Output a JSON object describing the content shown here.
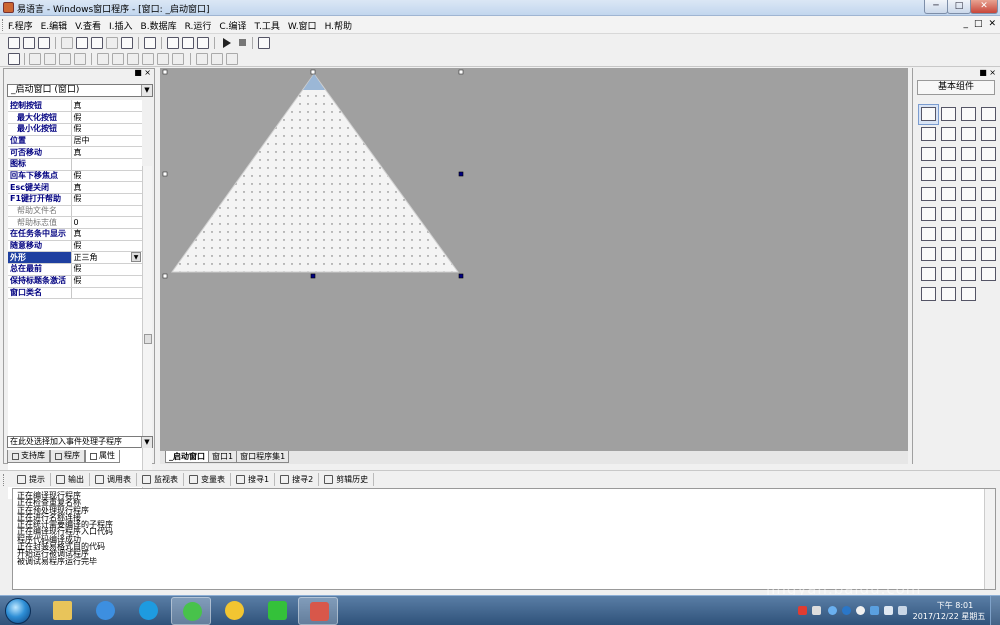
{
  "window": {
    "title": "易语言 - Windows窗口程序 - [窗口: _启动窗口]",
    "min_label": "─",
    "max_label": "□",
    "close_label": "✕"
  },
  "menu": {
    "items": [
      "F.程序",
      "E.编辑",
      "V.查看",
      "I.插入",
      "B.数据库",
      "R.运行",
      "C.编译",
      "T.工具",
      "W.窗口",
      "H.帮助"
    ],
    "mdi": [
      "_",
      "□",
      "✕"
    ]
  },
  "left_panel": {
    "header_controls": "■ ×",
    "window_select": "_启动窗口 (窗口)",
    "properties": [
      {
        "name": "控制按钮",
        "value": "真"
      },
      {
        "name": "最大化按钮",
        "value": "假",
        "sub": true
      },
      {
        "name": "最小化按钮",
        "value": "假",
        "sub": true
      },
      {
        "name": "位置",
        "value": "居中"
      },
      {
        "name": "可否移动",
        "value": "真"
      },
      {
        "name": "图标",
        "value": ""
      },
      {
        "name": "回车下移焦点",
        "value": "假"
      },
      {
        "name": "Esc键关闭",
        "value": "真"
      },
      {
        "name": "F1键打开帮助",
        "value": "假"
      },
      {
        "name": "帮助文件名",
        "value": "",
        "sub": true,
        "disabled": true
      },
      {
        "name": "帮助标志值",
        "value": "0",
        "sub": true,
        "disabled": true
      },
      {
        "name": "在任务条中显示",
        "value": "真"
      },
      {
        "name": "随意移动",
        "value": "假"
      },
      {
        "name": "外形",
        "value": "正三角",
        "selected": true
      },
      {
        "name": "总在最前",
        "value": "假"
      },
      {
        "name": "保持标题条激活",
        "value": "假"
      },
      {
        "name": "窗口类名",
        "value": ""
      }
    ],
    "event_select": "在此处选择加入事件处理子程序",
    "tabs": [
      "支持库",
      "程序",
      "属性"
    ]
  },
  "design": {
    "tabs": [
      "_启动窗口",
      "窗口1",
      "窗口程序集1"
    ]
  },
  "right_panel": {
    "header_controls": "■ ×",
    "title": "基本组件",
    "tool_icons": [
      "pointer-icon",
      "label-icon",
      "picture-icon",
      "shape-icon",
      "edit-icon",
      "frame-icon",
      "text-icon",
      "line-icon",
      "checkbox-icon",
      "radio-icon",
      "button-icon",
      "list-icon",
      "combo-icon",
      "hscroll-icon",
      "vscroll-icon",
      "progress-icon",
      "slider-icon",
      "tab-icon",
      "timer-icon",
      "db-icon",
      "grid-icon",
      "calendar-icon",
      "tree-icon",
      "image-list-icon",
      "toolbar-icon",
      "statusbar-icon",
      "rich-edit-icon",
      "ip-icon",
      "animation-icon",
      "socket-icon",
      "serial-icon",
      "printer-icon",
      "report-icon",
      "chart-icon",
      "dde-icon",
      "odbc-icon",
      "data-source-icon",
      "provider-icon",
      "odbc-conn-icon"
    ]
  },
  "output": {
    "tabs": [
      "提示",
      "输出",
      "调用表",
      "监视表",
      "变量表",
      "搜寻1",
      "搜寻2",
      "剪辑历史"
    ],
    "lines": [
      "正在编译现行程序",
      "正在检查重复名称",
      "正在预处理现行程序",
      "正在进行名称连接",
      "正在统计需要编译的子程序",
      "正在编译现行程序入口代码",
      "程序代码编译成功",
      "正在封装易格式目的代码",
      "开始运行被调试程序",
      "被调试易程序运行完毕"
    ]
  },
  "taskbar": {
    "apps": [
      "folder-icon",
      "ie-icon",
      "ie2-icon",
      "green-app-icon",
      "qq-music-icon",
      "iqiyi-icon",
      "eyuyan-icon"
    ],
    "time": "下午 8:01",
    "date": "2017/12/22 星期五"
  },
  "watermark": "jingyan.baidu.com"
}
